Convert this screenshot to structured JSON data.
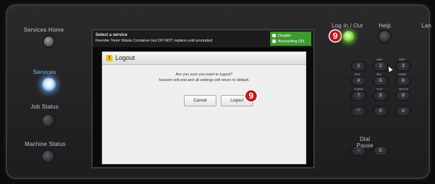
{
  "left_panel": {
    "services_home_label": "Services Home",
    "services_label": "Services",
    "job_status_label": "Job Status",
    "machine_status_label": "Machine Status"
  },
  "screen": {
    "topbar": {
      "line1": "Select a service",
      "line2": "Reorder Toner Waste Container but DO NOT replace until prompted"
    },
    "status": {
      "line1": "Disable",
      "line2": "Accounting ON"
    },
    "dialog": {
      "title": "Logout",
      "message_line1": "Are you sure you want to logout?",
      "message_line2": "Session will end and all settings will return to default.",
      "cancel_label": "Cancel",
      "logout_label": "Logout"
    }
  },
  "right_panel": {
    "log_in_out_label": "Log In / Out",
    "help_label": "Help",
    "language_label": "Lan",
    "dial_pause_label": "Dial Pause",
    "keypad": [
      {
        "num": "1",
        "sub": ""
      },
      {
        "num": "2",
        "sub": "ABC"
      },
      {
        "num": "3",
        "sub": "DEF"
      },
      {
        "num": "4",
        "sub": "GHI"
      },
      {
        "num": "5",
        "sub": "JKL"
      },
      {
        "num": "6",
        "sub": "MNO"
      },
      {
        "num": "7",
        "sub": "PQRS"
      },
      {
        "num": "8",
        "sub": "TUV"
      },
      {
        "num": "9",
        "sub": "WXYZ"
      },
      {
        "num": "*",
        "sub": ""
      },
      {
        "num": "0",
        "sub": ""
      },
      {
        "num": "#",
        "sub": ""
      },
      {
        "num": "-",
        "sub": ""
      },
      {
        "num": "C",
        "sub": ""
      }
    ]
  },
  "badges": {
    "login_badge": "9",
    "logout_badge": "9"
  },
  "colors": {
    "badge_red": "#c8161d",
    "status_green": "#3f9a2c",
    "services_lit_blue": "#3a7bd5",
    "login_green": "#8be04a"
  }
}
